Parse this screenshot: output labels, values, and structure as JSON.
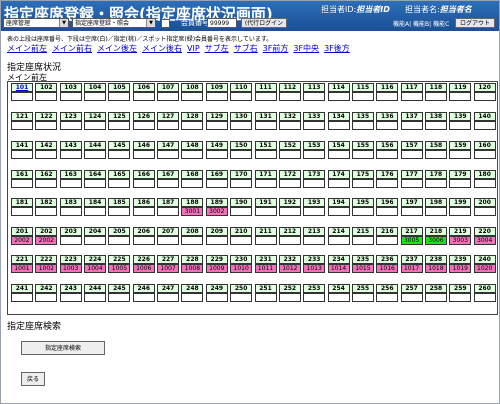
{
  "header": {
    "title": "指定座席登録・照会(指定座席状況画面)",
    "staff_id_label": "担当者ID:",
    "staff_id_value": "担当者ID",
    "staff_name_label": "担当者名:",
    "staff_name_value": "担当者名"
  },
  "toolbar": {
    "menu_select": "座席管理",
    "screen_select": "指定座席登録・照会",
    "member_label": "会員番号",
    "member_value": "99999",
    "member_button": "(代行ログイン",
    "function_links": "機能A| 機能B| 機能C",
    "logout_button": "ログアウト"
  },
  "info_text": "表の上段は座席番号、下段は空席(白)／指定(桃)／スポット指定席(緑)会員番号を表示しています。",
  "nav_links": [
    "メイン前左",
    "メイン前右",
    "メイン後左",
    "メイン後右",
    "VIP",
    "サブ左",
    "サブ右",
    "3F前方",
    "3F中央",
    "3F後方"
  ],
  "section_title": "指定座席状況",
  "area_title": "メイン前左",
  "colors": {
    "header": "#1b4f95",
    "seat": "#dfffdf",
    "reserved": "#f072b9",
    "spot": "#19e619"
  },
  "seat_rows": [
    {
      "seats": [
        "101",
        "102",
        "103",
        "104",
        "105",
        "106",
        "107",
        "108",
        "109",
        "110",
        "111",
        "112",
        "113",
        "114",
        "115",
        "116",
        "117",
        "118",
        "119",
        "120"
      ],
      "status": {}
    },
    {
      "seats": [
        "121",
        "122",
        "123",
        "124",
        "125",
        "126",
        "127",
        "128",
        "129",
        "130",
        "131",
        "132",
        "133",
        "134",
        "135",
        "136",
        "137",
        "138",
        "139",
        "140"
      ],
      "status": {}
    },
    {
      "seats": [
        "141",
        "142",
        "143",
        "144",
        "145",
        "146",
        "147",
        "148",
        "149",
        "150",
        "151",
        "152",
        "153",
        "154",
        "155",
        "156",
        "157",
        "158",
        "159",
        "160"
      ],
      "status": {}
    },
    {
      "seats": [
        "161",
        "162",
        "163",
        "164",
        "165",
        "166",
        "167",
        "168",
        "169",
        "170",
        "171",
        "172",
        "173",
        "174",
        "175",
        "176",
        "177",
        "178",
        "179",
        "180"
      ],
      "status": {}
    },
    {
      "seats": [
        "181",
        "182",
        "183",
        "184",
        "185",
        "186",
        "187",
        "188",
        "189",
        "190",
        "191",
        "192",
        "193",
        "194",
        "195",
        "196",
        "197",
        "198",
        "199",
        "200"
      ],
      "status": {
        "7": {
          "t": "pink",
          "v": "3001"
        },
        "8": {
          "t": "pink",
          "v": "3002"
        }
      }
    },
    {
      "seats": [
        "201",
        "202",
        "203",
        "204",
        "205",
        "206",
        "207",
        "208",
        "209",
        "210",
        "211",
        "212",
        "213",
        "214",
        "215",
        "216",
        "217",
        "218",
        "219",
        "220"
      ],
      "status": {
        "0": {
          "t": "pink",
          "v": "2002"
        },
        "1": {
          "t": "pink",
          "v": "2002"
        },
        "16": {
          "t": "green",
          "v": "3005"
        },
        "17": {
          "t": "green",
          "v": "3006"
        },
        "18": {
          "t": "pink",
          "v": "3003"
        },
        "19": {
          "t": "pink",
          "v": "3004"
        }
      }
    },
    {
      "seats": [
        "221",
        "222",
        "223",
        "224",
        "225",
        "226",
        "227",
        "228",
        "229",
        "230",
        "231",
        "232",
        "233",
        "234",
        "235",
        "236",
        "237",
        "238",
        "239",
        "240"
      ],
      "status": {
        "0": {
          "t": "pink",
          "v": "1001"
        },
        "1": {
          "t": "pink",
          "v": "1002"
        },
        "2": {
          "t": "pink",
          "v": "1003"
        },
        "3": {
          "t": "pink",
          "v": "1004"
        },
        "4": {
          "t": "pink",
          "v": "1005"
        },
        "5": {
          "t": "pink",
          "v": "1006"
        },
        "6": {
          "t": "pink",
          "v": "1007"
        },
        "7": {
          "t": "pink",
          "v": "1008"
        },
        "8": {
          "t": "pink",
          "v": "1009"
        },
        "9": {
          "t": "pink",
          "v": "1010"
        },
        "10": {
          "t": "pink",
          "v": "1011"
        },
        "11": {
          "t": "pink",
          "v": "1012"
        },
        "12": {
          "t": "pink",
          "v": "1013"
        },
        "13": {
          "t": "pink",
          "v": "1014"
        },
        "14": {
          "t": "pink",
          "v": "1015"
        },
        "15": {
          "t": "pink",
          "v": "1016"
        },
        "16": {
          "t": "pink",
          "v": "1017"
        },
        "17": {
          "t": "pink",
          "v": "1018"
        },
        "18": {
          "t": "pink",
          "v": "1019"
        },
        "19": {
          "t": "pink",
          "v": "1020"
        }
      }
    },
    {
      "seats": [
        "241",
        "242",
        "243",
        "244",
        "245",
        "246",
        "247",
        "248",
        "249",
        "250",
        "251",
        "252",
        "253",
        "254",
        "255",
        "256",
        "257",
        "258",
        "259",
        "260"
      ],
      "status": {}
    }
  ],
  "search_section_title": "指定座席検索",
  "search_button": "指定座席検索",
  "back_button": "戻る"
}
